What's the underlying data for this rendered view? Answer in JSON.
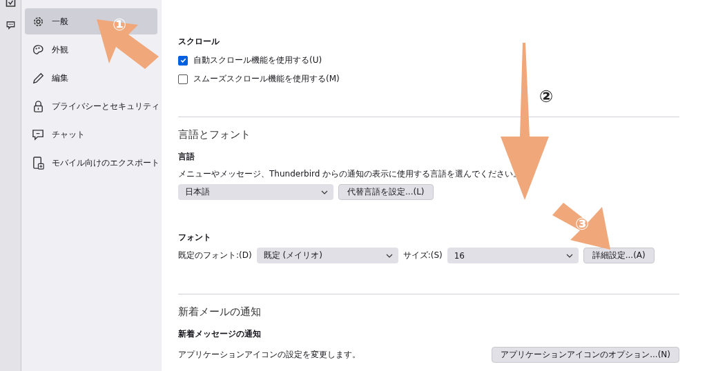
{
  "sidebar": {
    "items": [
      {
        "label": "一般",
        "selected": true
      },
      {
        "label": "外観",
        "selected": false
      },
      {
        "label": "編集",
        "selected": false
      },
      {
        "label": "プライバシーとセキュリティ",
        "selected": false
      },
      {
        "label": "チャット",
        "selected": false
      },
      {
        "label": "モバイル向けのエクスポート",
        "selected": false
      }
    ]
  },
  "scroll": {
    "title": "スクロール",
    "options": [
      {
        "label": "自動スクロール機能を使用する(U)",
        "checked": true
      },
      {
        "label": "スムーズスクロール機能を使用する(M)",
        "checked": false
      }
    ]
  },
  "language_and_fonts": {
    "heading": "言語とフォント",
    "language": {
      "title": "言語",
      "description": "メニューやメッセージ、Thunderbird からの通知の表示に使用する言語を選んでください。",
      "select": "日本語",
      "button": "代替言語を設定...(L)"
    },
    "fonts": {
      "title": "フォント",
      "default_font_label": "既定のフォント:(D)",
      "default_font": "既定 (メイリオ)",
      "size_label": "サイズ:(S)",
      "size": "16",
      "button": "詳細設定...(A)"
    }
  },
  "new_mail": {
    "heading": "新着メールの通知",
    "title": "新着メッセージの通知",
    "description": "アプリケーションアイコンの設定を変更します。",
    "button": "アプリケーションアイコンのオプション...(N)"
  },
  "annotations": [
    {
      "label": "①"
    },
    {
      "label": "②"
    },
    {
      "label": "③"
    }
  ]
}
